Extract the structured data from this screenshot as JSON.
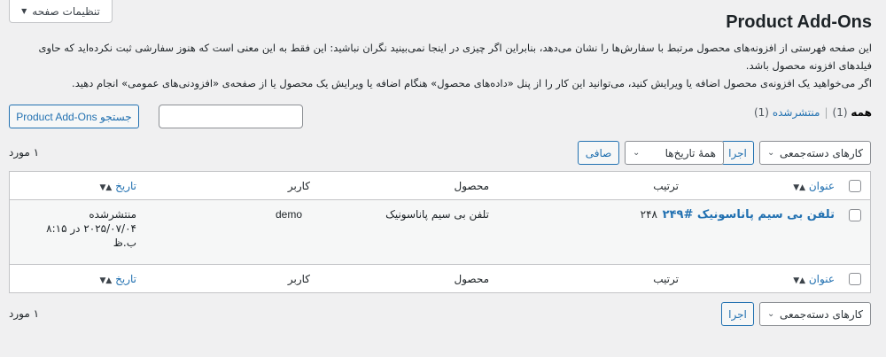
{
  "screen_options": {
    "label": "تنظیمات صفحه",
    "caret": "▼"
  },
  "page_title": "Product Add-Ons",
  "description": {
    "line1": "این صفحه فهرستی از افزونه‌های محصول مرتبط با سفارش‌ها را نشان می‌دهد، بنابراین اگر چیزی در اینجا نمی‌بینید نگران نباشید: این فقط به این معنی است که هنوز سفارشی ثبت نکرده‌اید که حاوی فیلدهای افزونه محصول باشد.",
    "line2": "اگر می‌خواهید یک افزونه‌ی محصول اضافه یا ویرایش کنید، می‌توانید این کار را از پنل «داده‌های محصول» هنگام اضافه یا ویرایش یک محصول یا از صفحه‌ی «افزودنی‌های عمومی» انجام دهید."
  },
  "views": {
    "all_label": "همه",
    "all_count": "(1)",
    "separator": "|",
    "published_label": "منتشرشده",
    "published_count": "(1)"
  },
  "search": {
    "value": "",
    "button_label": "جستجو Product Add-Ons"
  },
  "top_nav": {
    "bulk_actions": "کارهای دسته‌جمعی",
    "apply": "اجرا",
    "dates": "همهٔ تاریخ‌ها",
    "filter": "صافی",
    "item_count": "۱ مورد"
  },
  "bottom_nav": {
    "bulk_actions": "کارهای دسته‌جمعی",
    "apply": "اجرا",
    "item_count": "۱ مورد"
  },
  "columns": {
    "title": "عنوان",
    "order": "ترتیب",
    "product": "محصول",
    "user": "کاربر",
    "date": "تاریخ"
  },
  "rows": [
    {
      "title": "تلفن بی سیم پاناسونیک #۲۴۹",
      "order": "۲۴۸",
      "product": "تلفن بی سیم پاناسونیک",
      "user": "demo",
      "date_status": "منتشرشده",
      "date_value": "۲۰۲۵/۰۷/۰۴ در ۸:۱۵",
      "date_period": "ب.ظ"
    }
  ],
  "icons": {
    "sort": "sort-arrows-icon",
    "chevron": "chevron-down-icon"
  },
  "colors": {
    "link": "#2271b1",
    "background": "#f0f0f1",
    "border": "#c3c4c7"
  }
}
